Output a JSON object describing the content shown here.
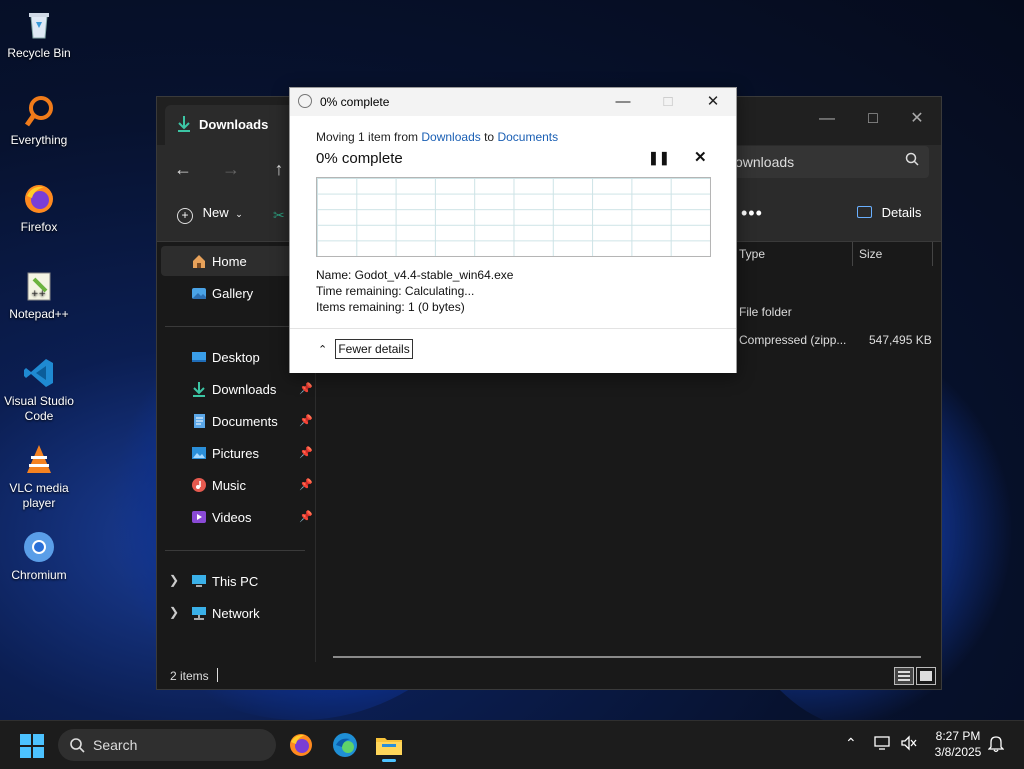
{
  "desktop": {
    "icons": [
      {
        "label": "Recycle Bin",
        "icon": "recycle-bin-icon"
      },
      {
        "label": "Everything",
        "icon": "everything-icon"
      },
      {
        "label": "Firefox",
        "icon": "firefox-icon"
      },
      {
        "label": "Notepad++",
        "icon": "notepad-plus-plus-icon"
      },
      {
        "label": "Visual Studio Code",
        "icon": "vscode-icon"
      },
      {
        "label": "VLC media player",
        "icon": "vlc-icon"
      },
      {
        "label": "Chromium",
        "icon": "chromium-icon"
      }
    ]
  },
  "explorer": {
    "tab_title": "Downloads",
    "address_text": "ownloads",
    "toolbar": {
      "new_label": "New",
      "more_label": "•••",
      "details_label": "Details"
    },
    "sidebar": {
      "home": "Home",
      "gallery": "Gallery",
      "desktop": "Desktop",
      "downloads": "Downloads",
      "documents": "Documents",
      "pictures": "Pictures",
      "music": "Music",
      "videos": "Videos",
      "this_pc": "This PC",
      "network": "Network"
    },
    "columns": {
      "type": "Type",
      "size": "Size"
    },
    "rows": [
      {
        "type": "File folder",
        "size": ""
      },
      {
        "type": "Compressed (zipp...",
        "size": "547,495 KB"
      }
    ],
    "status": "2 items"
  },
  "dialog": {
    "title": "0% complete",
    "moving_prefix": "Moving 1 item from ",
    "from": "Downloads",
    "to_word": " to ",
    "to": "Documents",
    "progress_text": "0% complete",
    "name_line": "Name:  Godot_v4.4-stable_win64.exe",
    "time_line": "Time remaining:  Calculating...",
    "items_line": "Items remaining:  1 (0 bytes)",
    "fewer_details": "Fewer details"
  },
  "taskbar": {
    "search_label": "Search",
    "time": "8:27 PM",
    "date": "3/8/2025"
  },
  "colors": {
    "accent": "#1a5fb4",
    "taskbar": "#1c1c1c",
    "explorer_bg": "#191919"
  }
}
